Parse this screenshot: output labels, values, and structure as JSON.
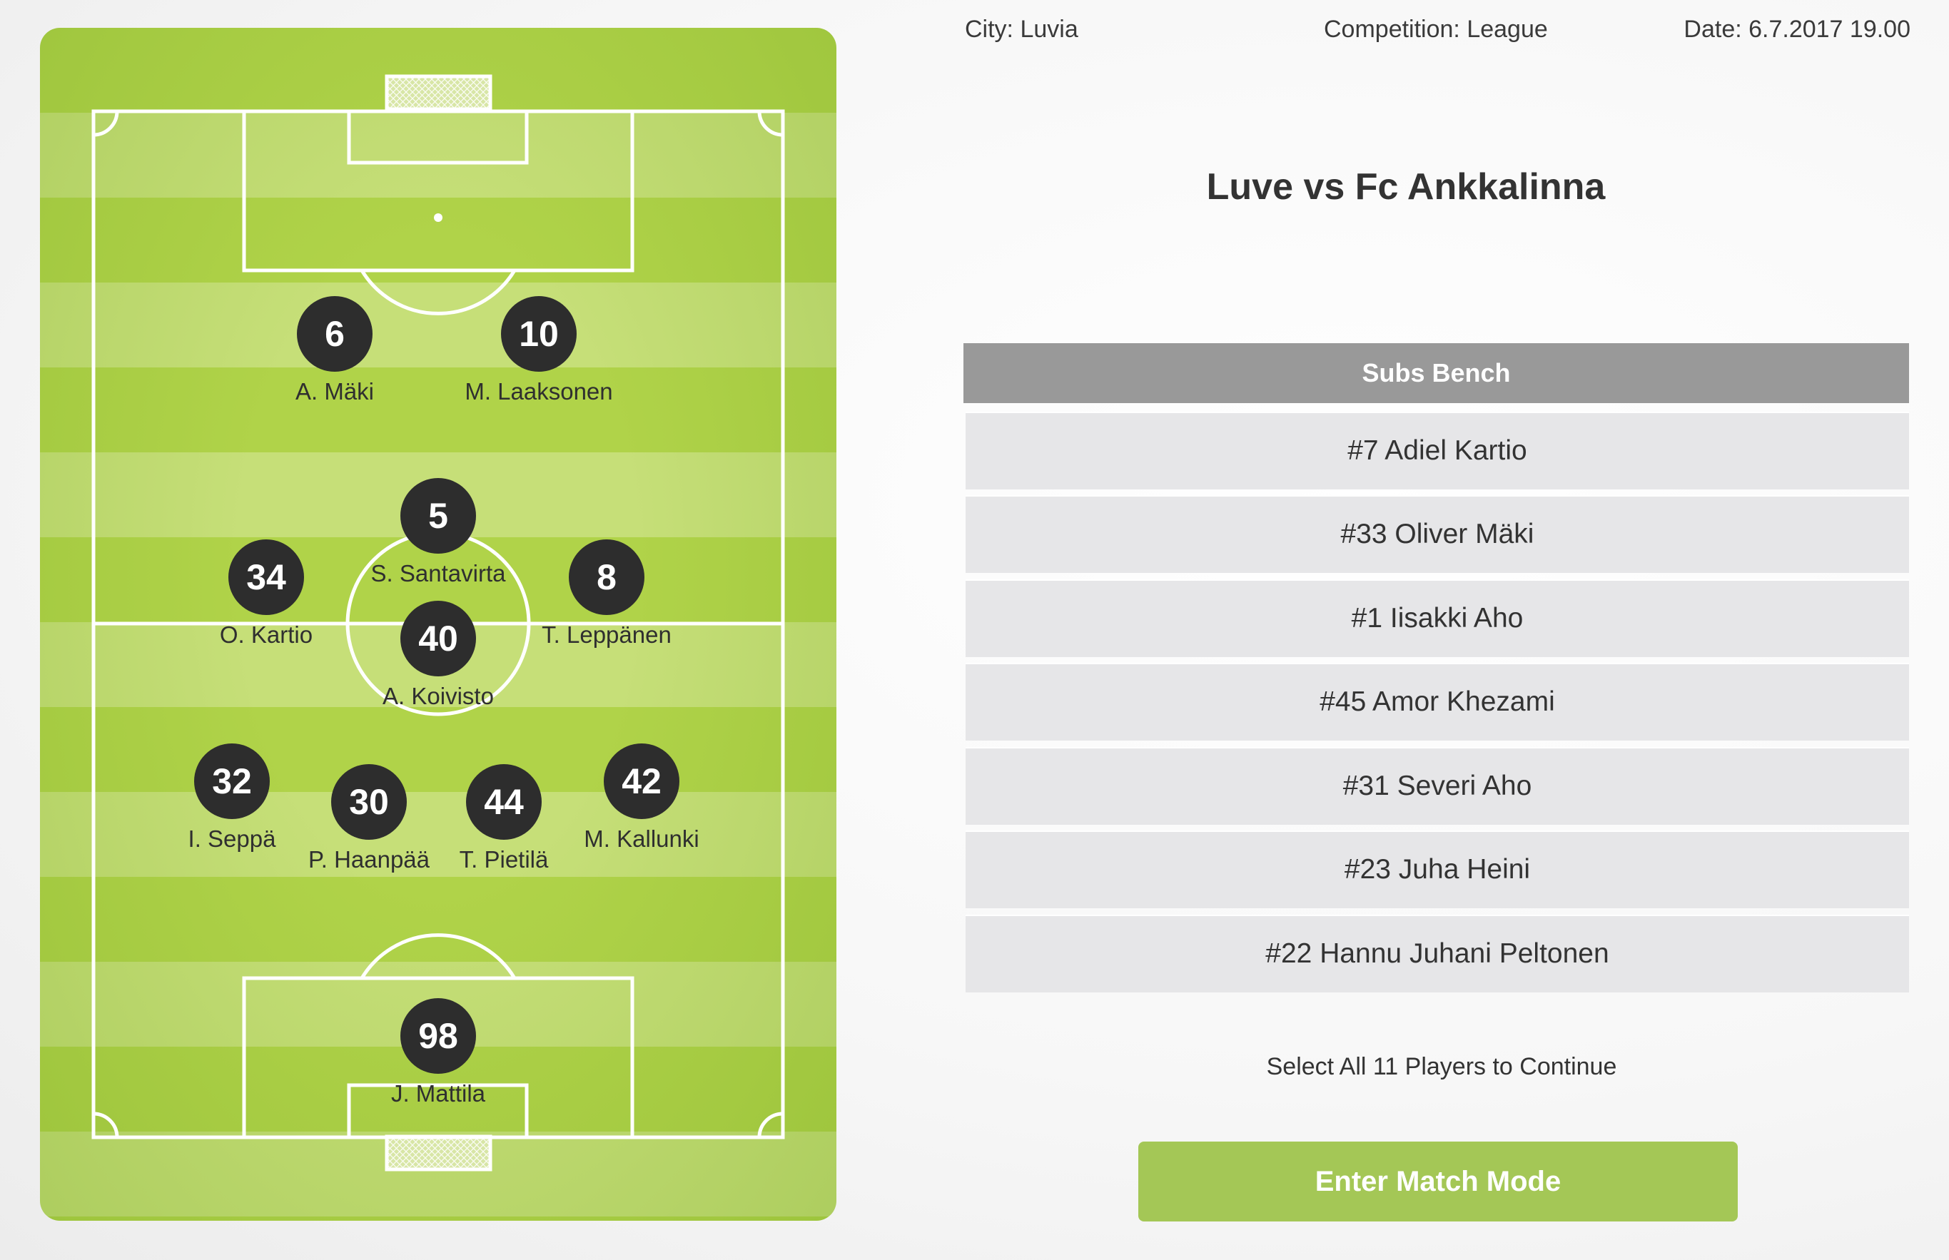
{
  "header": {
    "city": "City: Luvia",
    "competition": "Competition: League",
    "date": "Date: 6.7.2017 19.00"
  },
  "match_title": "Luve vs Fc Ankkalinna",
  "lineup": [
    {
      "number": "6",
      "name": "A. Mäki"
    },
    {
      "number": "10",
      "name": "M. Laaksonen"
    },
    {
      "number": "5",
      "name": "S. Santavirta"
    },
    {
      "number": "34",
      "name": "O. Kartio"
    },
    {
      "number": "8",
      "name": "T. Leppänen"
    },
    {
      "number": "40",
      "name": "A. Koivisto"
    },
    {
      "number": "32",
      "name": "I. Seppä"
    },
    {
      "number": "30",
      "name": "P. Haanpää"
    },
    {
      "number": "44",
      "name": "T. Pietilä"
    },
    {
      "number": "42",
      "name": "M. Kallunki"
    },
    {
      "number": "98",
      "name": "J. Mattila"
    }
  ],
  "bench": {
    "title": "Subs Bench",
    "players": [
      "#7 Adiel Kartio",
      "#33 Oliver Mäki",
      "#1 Iisakki Aho",
      "#45 Amor Khezami",
      "#31 Severi Aho",
      "#23 Juha Heini",
      "#22 Hannu Juhani Peltonen"
    ]
  },
  "instruction": "Select All 11 Players to Continue",
  "enter_button": "Enter Match Mode",
  "colors": {
    "pitch_green": "#b0d349",
    "pitch_stripe": "#c6df78",
    "player_disc": "#2d2d2d",
    "bench_header": "#999999",
    "bench_row": "#e6e6e8",
    "button": "#a4c756"
  }
}
